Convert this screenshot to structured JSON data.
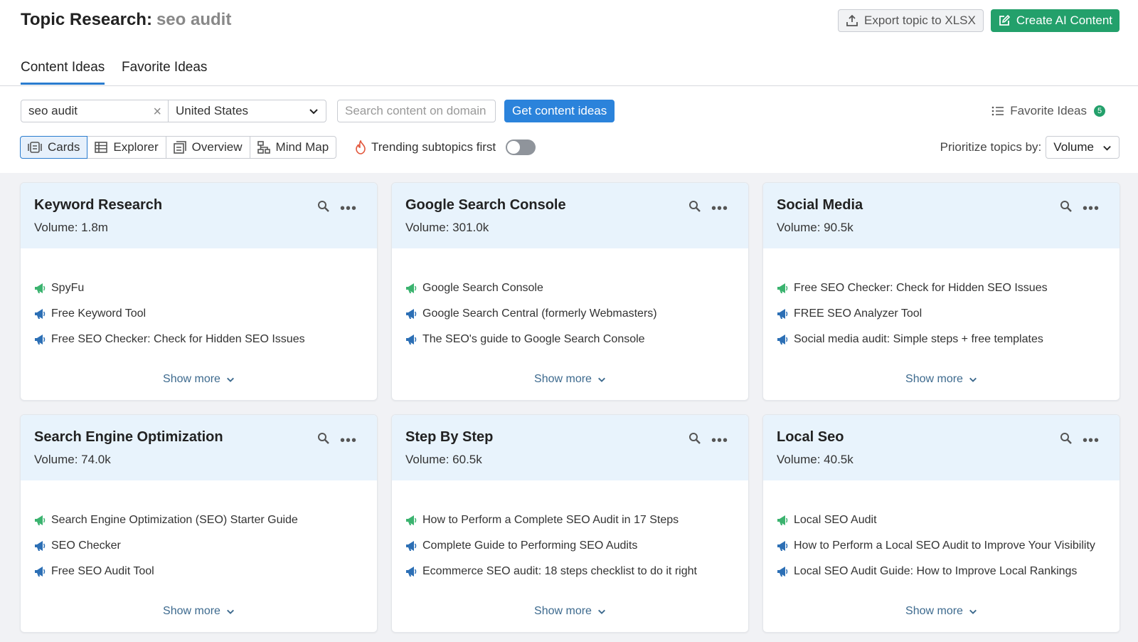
{
  "header": {
    "title_prefix": "Topic Research:",
    "title_query": "seo audit",
    "export_label": "Export topic to XLSX",
    "create_label": "Create AI Content"
  },
  "tabs": [
    {
      "label": "Content Ideas",
      "active": true
    },
    {
      "label": "Favorite Ideas",
      "active": false
    }
  ],
  "search": {
    "keyword_value": "seo audit",
    "country_value": "United States",
    "domain_placeholder": "Search content on domain",
    "get_ideas_label": "Get content ideas",
    "favorite_label": "Favorite Ideas",
    "favorite_count": "5"
  },
  "views": {
    "buttons": [
      {
        "label": "Cards",
        "active": true
      },
      {
        "label": "Explorer",
        "active": false
      },
      {
        "label": "Overview",
        "active": false
      },
      {
        "label": "Mind Map",
        "active": false
      }
    ],
    "trending_label": "Trending subtopics first",
    "trending_enabled": false,
    "prioritize_label": "Prioritize topics by:",
    "prioritize_value": "Volume"
  },
  "colors": {
    "accent": "#2b83db",
    "green": "#23a06b",
    "card_head": "#e8f3fc"
  },
  "cards": [
    {
      "title": "Keyword Research",
      "volume_label": "Volume:",
      "volume": "1.8m",
      "items": [
        {
          "text": "SpyFu",
          "icon": "green-megaphone-icon"
        },
        {
          "text": "Free Keyword Tool",
          "icon": "blue-megaphone-icon"
        },
        {
          "text": "Free SEO Checker: Check for Hidden SEO Issues",
          "icon": "blue-megaphone-icon"
        }
      ],
      "show_more": "Show more"
    },
    {
      "title": "Google Search Console",
      "volume_label": "Volume:",
      "volume": "301.0k",
      "items": [
        {
          "text": "Google Search Console",
          "icon": "green-megaphone-icon"
        },
        {
          "text": "Google Search Central (formerly Webmasters)",
          "icon": "blue-megaphone-icon"
        },
        {
          "text": "The SEO's guide to Google Search Console",
          "icon": "blue-megaphone-icon"
        }
      ],
      "show_more": "Show more"
    },
    {
      "title": "Social Media",
      "volume_label": "Volume:",
      "volume": "90.5k",
      "items": [
        {
          "text": "Free SEO Checker: Check for Hidden SEO Issues",
          "icon": "green-megaphone-icon"
        },
        {
          "text": "FREE SEO Analyzer Tool",
          "icon": "blue-megaphone-icon"
        },
        {
          "text": "Social media audit: Simple steps + free templates",
          "icon": "blue-megaphone-icon"
        }
      ],
      "show_more": "Show more"
    },
    {
      "title": "Search Engine Optimization",
      "volume_label": "Volume:",
      "volume": "74.0k",
      "items": [
        {
          "text": "Search Engine Optimization (SEO) Starter Guide",
          "icon": "green-megaphone-icon"
        },
        {
          "text": "SEO Checker",
          "icon": "blue-megaphone-icon"
        },
        {
          "text": "Free SEO Audit Tool",
          "icon": "blue-megaphone-icon"
        }
      ],
      "show_more": "Show more"
    },
    {
      "title": "Step By Step",
      "volume_label": "Volume:",
      "volume": "60.5k",
      "items": [
        {
          "text": "How to Perform a Complete SEO Audit in 17 Steps",
          "icon": "green-megaphone-icon"
        },
        {
          "text": "Complete Guide to Performing SEO Audits",
          "icon": "blue-megaphone-icon"
        },
        {
          "text": "Ecommerce SEO audit: 18 steps checklist to do it right",
          "icon": "blue-megaphone-icon"
        }
      ],
      "show_more": "Show more"
    },
    {
      "title": "Local Seo",
      "volume_label": "Volume:",
      "volume": "40.5k",
      "items": [
        {
          "text": "Local SEO Audit",
          "icon": "green-megaphone-icon"
        },
        {
          "text": "How to Perform a Local SEO Audit to Improve Your Visibility",
          "icon": "blue-megaphone-icon"
        },
        {
          "text": "Local SEO Audit Guide: How to Improve Local Rankings",
          "icon": "blue-megaphone-icon"
        }
      ],
      "show_more": "Show more"
    }
  ]
}
